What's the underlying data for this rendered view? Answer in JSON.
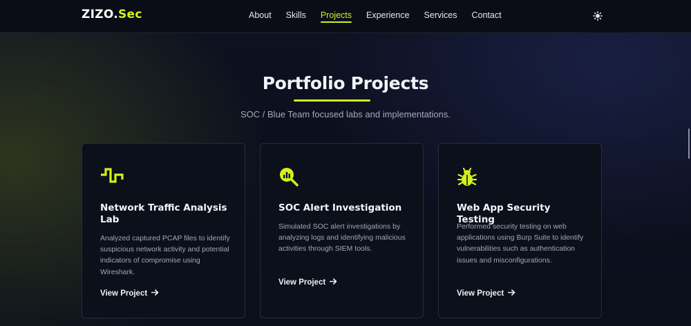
{
  "brand": {
    "part1": "ZIZO.",
    "part2": "Sec"
  },
  "nav": {
    "items": [
      {
        "label": "About"
      },
      {
        "label": "Skills"
      },
      {
        "label": "Projects"
      },
      {
        "label": "Experience"
      },
      {
        "label": "Services"
      },
      {
        "label": "Contact"
      }
    ],
    "active": "Projects"
  },
  "theme_toggle_icon": "sun-icon",
  "section": {
    "title": "Portfolio Projects",
    "subtitle": "SOC / Blue Team focused labs and implementations."
  },
  "projects": [
    {
      "icon": "pulse-wave-icon",
      "title": "Network Traffic Analysis Lab",
      "description": "Analyzed captured PCAP files to identify suspicious network activity and potential indicators of compromise using Wireshark.",
      "link": "View Project",
      "link_icon": "arrow-right-icon"
    },
    {
      "icon": "magnifier-chart-icon",
      "title": "SOC Alert Investigation",
      "description": "Simulated SOC alert investigations by analyzing logs and identifying malicious activities through SIEM tools.",
      "link": "View Project",
      "link_icon": "arrow-right-icon"
    },
    {
      "icon": "bug-icon",
      "title": "Web App Security Testing",
      "description": "Performed security testing on web applications using Burp Suite to identify vulnerabilities such as authentication issues and misconfigurations.",
      "link": "View Project",
      "link_icon": "arrow-right-icon"
    }
  ],
  "colors": {
    "accent": "#d4f01e",
    "background": "#0b0f1a",
    "card": "#0c101b"
  }
}
